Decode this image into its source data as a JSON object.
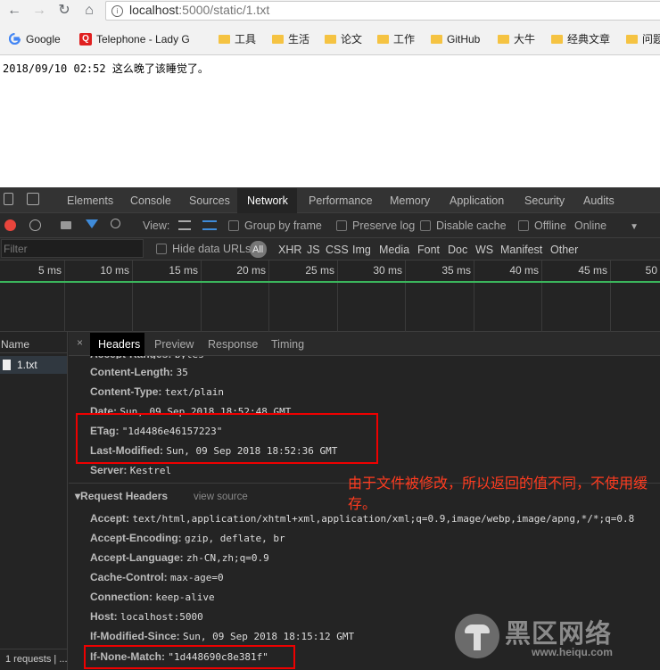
{
  "browser": {
    "url_host": "localhost",
    "url_rest": ":5000/static/1.txt",
    "bookmarks": [
      "Google",
      "Telephone - Lady G",
      "工具",
      "生活",
      "论文",
      "工作",
      "GitHub",
      "大牛",
      "经典文章",
      "问题"
    ]
  },
  "page": {
    "text": "2018/09/10 02:52 这么晚了该睡觉了。"
  },
  "devtools": {
    "tabs": [
      "Elements",
      "Console",
      "Sources",
      "Network",
      "Performance",
      "Memory",
      "Application",
      "Security",
      "Audits"
    ],
    "active_tab": "Network",
    "toolbar": {
      "view_label": "View:",
      "group_by_frame": "Group by frame",
      "preserve_log": "Preserve log",
      "disable_cache": "Disable cache",
      "offline": "Offline",
      "online": "Online"
    },
    "filter": {
      "placeholder": "Filter",
      "hide_data_urls": "Hide data URLs",
      "types": [
        "All",
        "XHR",
        "JS",
        "CSS",
        "Img",
        "Media",
        "Font",
        "Doc",
        "WS",
        "Manifest",
        "Other"
      ]
    },
    "timeline_ticks": [
      "5 ms",
      "10 ms",
      "15 ms",
      "20 ms",
      "25 ms",
      "30 ms",
      "35 ms",
      "40 ms",
      "45 ms",
      "50"
    ],
    "name_column": "Name",
    "requests": [
      "1.txt"
    ],
    "status": "1 requests | ...",
    "detail_tabs": [
      "Headers",
      "Preview",
      "Response",
      "Timing"
    ],
    "response_headers": [
      {
        "name": "Content-Length:",
        "value": "35"
      },
      {
        "name": "Content-Type:",
        "value": "text/plain"
      },
      {
        "name": "Date:",
        "value": "Sun, 09 Sep 2018 18:52:48 GMT"
      },
      {
        "name": "ETag:",
        "value": "\"1d4486e46157223\""
      },
      {
        "name": "Last-Modified:",
        "value": "Sun, 09 Sep 2018 18:52:36 GMT"
      },
      {
        "name": "Server:",
        "value": "Kestrel"
      }
    ],
    "request_headers_title": "▾Request Headers",
    "view_source": "view source",
    "request_headers": [
      {
        "name": "Accept:",
        "value": "text/html,application/xhtml+xml,application/xml;q=0.9,image/webp,image/apng,*/*;q=0.8"
      },
      {
        "name": "Accept-Encoding:",
        "value": "gzip, deflate, br"
      },
      {
        "name": "Accept-Language:",
        "value": "zh-CN,zh;q=0.9"
      },
      {
        "name": "Cache-Control:",
        "value": "max-age=0"
      },
      {
        "name": "Connection:",
        "value": "keep-alive"
      },
      {
        "name": "Host:",
        "value": "localhost:5000"
      },
      {
        "name": "If-Modified-Since:",
        "value": "Sun, 09 Sep 2018 18:15:12 GMT"
      },
      {
        "name": "If-None-Match:",
        "value": "\"1d448690c8e381f\""
      }
    ]
  },
  "annotation": "由于文件被修改，所以返回的值不同，不使用缓存。",
  "watermark": {
    "text": "黑区网络",
    "url": "www.heiqu.com"
  }
}
